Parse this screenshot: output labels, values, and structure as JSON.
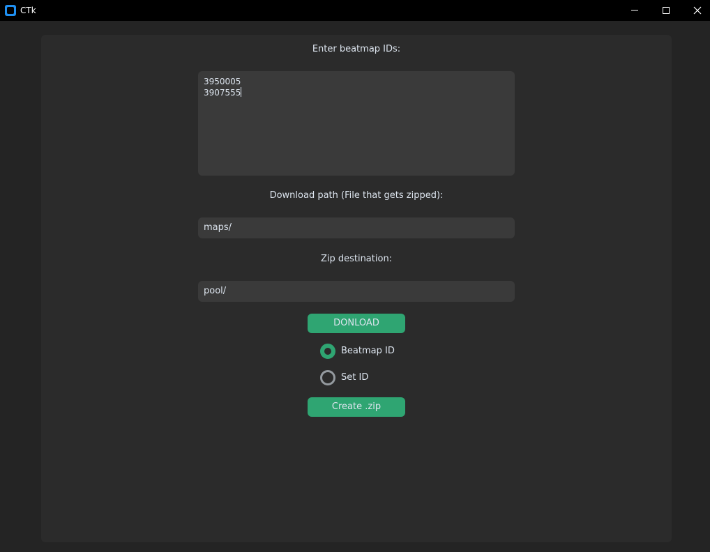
{
  "window": {
    "title": "CTk"
  },
  "icons": {
    "app": "app-icon",
    "minimize": "minimize-icon",
    "maximize": "maximize-icon",
    "close": "close-icon"
  },
  "form": {
    "ids_label": "Enter beatmap IDs:",
    "ids_lines": [
      "3950005",
      "3907555"
    ],
    "download_path_label": "Download path (File that gets zipped):",
    "download_path_value": "maps/",
    "zip_dest_label": "Zip destination:",
    "zip_dest_value": "pool/",
    "download_button": "DONLOAD",
    "radio_options": [
      {
        "label": "Beatmap ID",
        "checked": true
      },
      {
        "label": "Set ID",
        "checked": false
      }
    ],
    "create_zip_button": "Create .zip"
  },
  "colors": {
    "accent": "#2fa572",
    "window_bg": "#242424",
    "frame_bg": "#2b2b2b",
    "field_bg": "#3a3a3a",
    "text": "#dce4ee"
  }
}
